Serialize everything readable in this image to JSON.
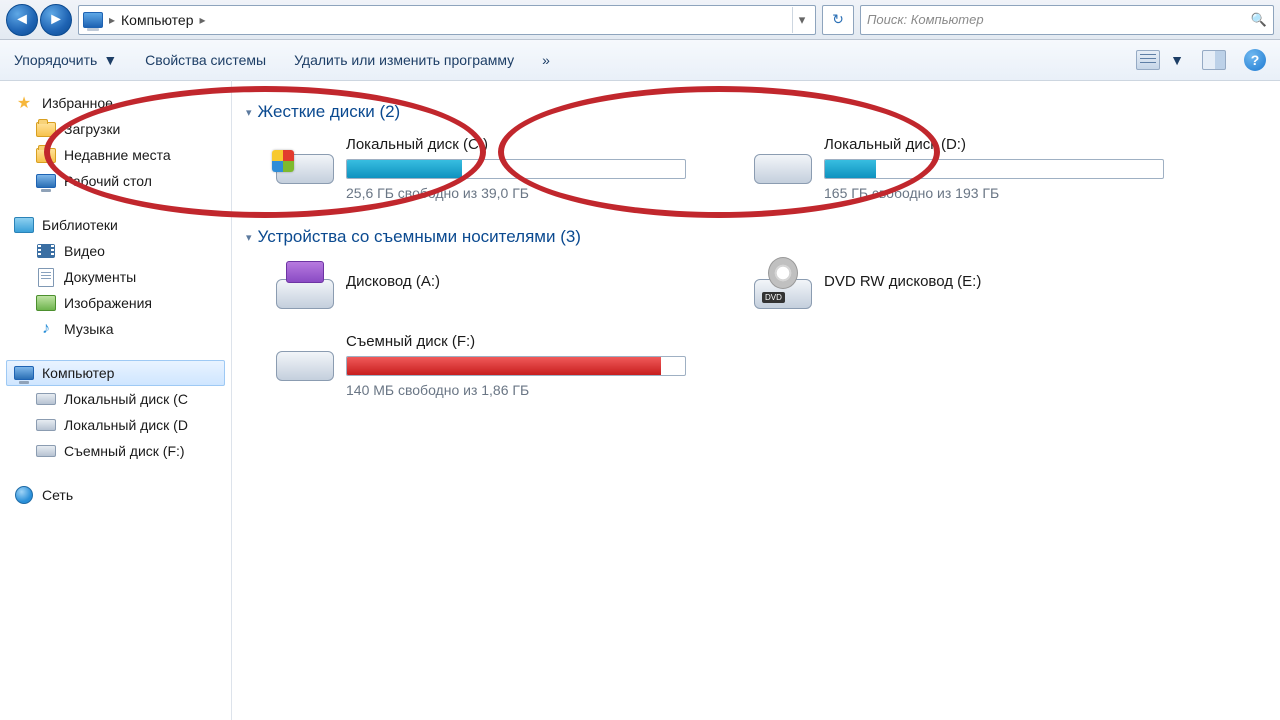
{
  "breadcrumb": {
    "root": "Компьютер"
  },
  "search": {
    "placeholder": "Поиск: Компьютер"
  },
  "toolbar": {
    "organize": "Упорядочить",
    "sysprops": "Свойства системы",
    "uninstall": "Удалить или изменить программу",
    "more": "»"
  },
  "sidebar": {
    "favorites": {
      "header": "Избранное",
      "items": [
        "Загрузки",
        "Недавние места",
        "Рабочий стол"
      ]
    },
    "libraries": {
      "header": "Библиотеки",
      "items": [
        "Видео",
        "Документы",
        "Изображения",
        "Музыка"
      ]
    },
    "computer": {
      "header": "Компьютер",
      "items": [
        "Локальный диск  (С",
        "Локальный диск (D",
        "Съемный диск (F:)"
      ]
    },
    "network": {
      "header": "Сеть"
    }
  },
  "sections": {
    "hdd": "Жесткие диски (2)",
    "removable": "Устройства со съемными носителями (3)"
  },
  "drives": {
    "c": {
      "title": "Локальный диск  (С:)",
      "sub": "25,6 ГБ свободно из 39,0 ГБ",
      "usedPct": 34
    },
    "d": {
      "title": "Локальный диск (D:)",
      "sub": "165 ГБ свободно из 193 ГБ",
      "usedPct": 15
    },
    "a": {
      "title": "Дисковод (A:)"
    },
    "e": {
      "title": "DVD RW дисковод (E:)"
    },
    "f": {
      "title": "Съемный диск (F:)",
      "sub": "140 МБ свободно из 1,86 ГБ",
      "usedPct": 93
    }
  }
}
